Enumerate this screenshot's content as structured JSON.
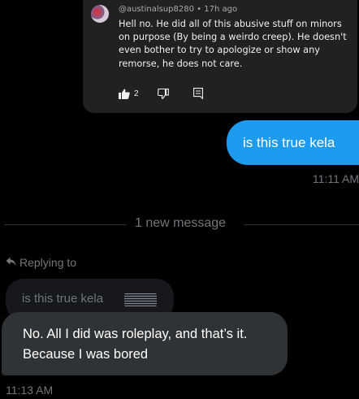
{
  "shared_comment": {
    "author": "@austinalsup8280",
    "separator": "•",
    "age": "17h ago",
    "text": "Hell no. He did all of this abusive stuff on minors on purpose (By being a weirdo creep). He doesn't even bother to try to apologize or show any remorse, he does not care.",
    "like_count": "2",
    "icons": [
      "thumbs-up-icon",
      "thumbs-down-icon",
      "reply-comment-icon"
    ]
  },
  "outgoing_message": {
    "text": "is this true kela",
    "time": "11:11 AM",
    "color": "#1d9bf0"
  },
  "divider": {
    "label": "1 new message"
  },
  "reply_context": {
    "label": "Replying to",
    "icon": "reply-arrow-icon",
    "quoted_text": "is this true kela"
  },
  "incoming_message": {
    "text": "No. All I did was roleplay, and that’s it. Because I was bored",
    "time": "11:13 AM"
  },
  "colors": {
    "background": "#000000",
    "incoming_bubble": "#2f3336",
    "muted_text": "#71767b"
  }
}
